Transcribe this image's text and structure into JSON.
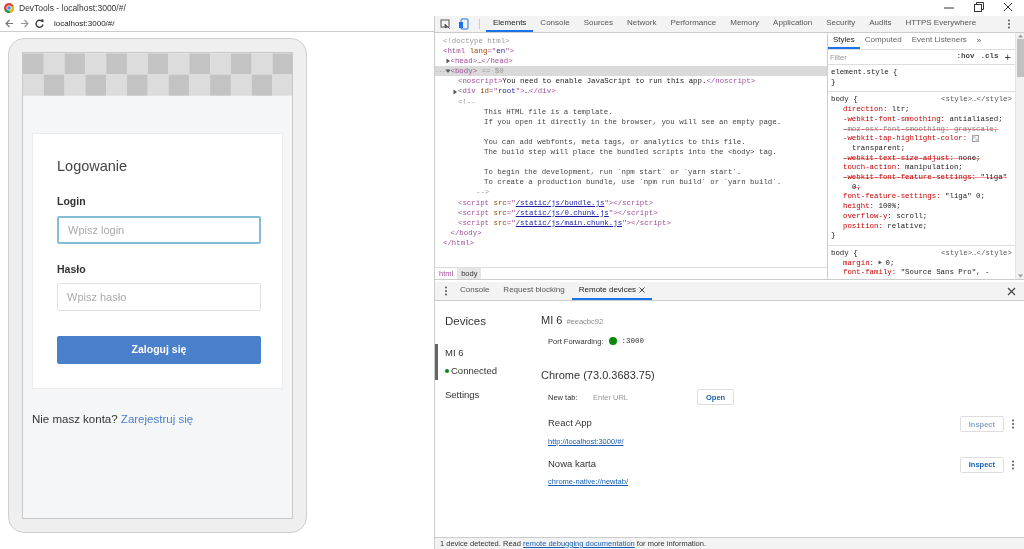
{
  "window": {
    "title": "DevTools - localhost:3000/#/"
  },
  "address_bar": {
    "url": "localhost:3000/#/"
  },
  "phone": {
    "heading": "Logowanie",
    "fields": [
      {
        "label": "Login",
        "placeholder": "Wpisz login",
        "focused": true
      },
      {
        "label": "Hasło",
        "placeholder": "Wpisz hasło",
        "focused": false
      }
    ],
    "submit": "Zaloguj się",
    "signup_prompt": "Nie masz konta?",
    "signup_link": "Zarejestruj się"
  },
  "devtools": {
    "tabs": [
      {
        "label": "Elements",
        "selected": true
      },
      {
        "label": "Console",
        "selected": false
      },
      {
        "label": "Sources",
        "selected": false
      },
      {
        "label": "Network",
        "selected": false
      },
      {
        "label": "Performance",
        "selected": false
      },
      {
        "label": "Memory",
        "selected": false
      },
      {
        "label": "Application",
        "selected": false
      },
      {
        "label": "Security",
        "selected": false
      },
      {
        "label": "Audits",
        "selected": false
      },
      {
        "label": "HTTPS Everywhere",
        "selected": false
      }
    ],
    "elements": {
      "tree": [
        {
          "selected": false,
          "parts": [
            {
              "kind": "muted",
              "text": "<!doctype html>"
            }
          ]
        },
        {
          "selected": false,
          "parts": [
            {
              "kind": "tag",
              "text": "<html "
            },
            {
              "kind": "attr",
              "text": "lang"
            },
            {
              "kind": "tag",
              "text": "=\""
            },
            {
              "kind": "val",
              "text": "en"
            },
            {
              "kind": "tag",
              "text": "\">"
            }
          ],
          "children": [
            {
              "selected": false,
              "expanded": false,
              "parts": [
                {
                  "kind": "tag",
                  "text": "<head>"
                },
                {
                  "kind": "plain",
                  "text": "…"
                },
                {
                  "kind": "tag",
                  "text": "</head>"
                }
              ]
            },
            {
              "selected": true,
              "expanded": true,
              "gutter": "...",
              "parts": [
                {
                  "kind": "tag",
                  "text": "<body>"
                },
                {
                  "kind": "muted",
                  "text": " == $0"
                }
              ],
              "children": [
                {
                  "selected": false,
                  "parts": [
                    {
                      "kind": "tag",
                      "text": "<noscript>"
                    },
                    {
                      "kind": "plain",
                      "text": "You need to enable JavaScript to run this app."
                    },
                    {
                      "kind": "tag",
                      "text": "</noscript>"
                    }
                  ]
                },
                {
                  "selected": false,
                  "expanded": false,
                  "parts": [
                    {
                      "kind": "tag",
                      "text": "<div "
                    },
                    {
                      "kind": "attr",
                      "text": "id"
                    },
                    {
                      "kind": "tag",
                      "text": "=\""
                    },
                    {
                      "kind": "val",
                      "text": "root"
                    },
                    {
                      "kind": "tag",
                      "text": "\">"
                    },
                    {
                      "kind": "plain",
                      "text": "…"
                    },
                    {
                      "kind": "tag",
                      "text": "</div>"
                    }
                  ]
                },
                {
                  "selected": false,
                  "parts": [
                    {
                      "kind": "muted",
                      "text": "<!--"
                    }
                  ],
                  "paragraphs": [
                    [
                      "This HTML file is a template.",
                      "If you open it directly in the browser, you will see an empty page."
                    ],
                    [
                      "You can add webfonts, meta tags, or analytics to this file.",
                      "The build step will place the bundled scripts into the <body> tag."
                    ],
                    [
                      "To begin the development, run `npm start` or `yarn start`.",
                      "To create a production bundle, use `npm run build` or `yarn build`."
                    ]
                  ],
                  "close": "-->"
                },
                {
                  "selected": false,
                  "parts": [
                    {
                      "kind": "tag",
                      "text": "<script "
                    },
                    {
                      "kind": "attr",
                      "text": "src"
                    },
                    {
                      "kind": "tag",
                      "text": "=\""
                    },
                    {
                      "kind": "link",
                      "text": "/static/js/bundle.js"
                    },
                    {
                      "kind": "tag",
                      "text": "\"></script>"
                    }
                  ]
                },
                {
                  "selected": false,
                  "parts": [
                    {
                      "kind": "tag",
                      "text": "<script "
                    },
                    {
                      "kind": "attr",
                      "text": "src"
                    },
                    {
                      "kind": "tag",
                      "text": "=\""
                    },
                    {
                      "kind": "link",
                      "text": "/static/js/0.chunk.js"
                    },
                    {
                      "kind": "tag",
                      "text": "\"></script>"
                    }
                  ]
                },
                {
                  "selected": false,
                  "parts": [
                    {
                      "kind": "tag",
                      "text": "<script "
                    },
                    {
                      "kind": "attr",
                      "text": "src"
                    },
                    {
                      "kind": "tag",
                      "text": "=\""
                    },
                    {
                      "kind": "link",
                      "text": "/static/js/main.chunk.js"
                    },
                    {
                      "kind": "tag",
                      "text": "\"></script>"
                    }
                  ]
                }
              ],
              "close": "</body>"
            }
          ],
          "close": "</html>"
        }
      ],
      "breadcrumbs": [
        {
          "label": "html",
          "selected": false
        },
        {
          "label": "body",
          "selected": true
        }
      ]
    },
    "styles": {
      "tabs": [
        {
          "label": "Styles",
          "selected": true
        },
        {
          "label": "Computed",
          "selected": false
        },
        {
          "label": "Event Listeners",
          "selected": false
        }
      ],
      "more": "»",
      "filter_placeholder": "Filter",
      "hov": ":hov",
      "cls": ".cls",
      "add": "+",
      "rules": [
        {
          "selector": "element.style {",
          "close": "}"
        },
        {
          "selector": "body {",
          "source": "<style>…</style>",
          "close": "}",
          "declarations": [
            {
              "name": "direction:",
              "value": "ltr;",
              "struck": false,
              "inactive": false
            },
            {
              "name": "-webkit-font-smoothing:",
              "value": "antialiased;",
              "struck": false,
              "inactive": false
            },
            {
              "name": "-moz-osx-font-smoothing:",
              "value": "grayscale;",
              "struck": true,
              "inactive": true
            },
            {
              "name": "-webkit-tap-highlight-color:",
              "value": "transparent;",
              "struck": false,
              "inactive": false,
              "swatch": true
            },
            {
              "name": "-webkit-text-size-adjust:",
              "value": "none;",
              "struck": true,
              "inactive": false
            },
            {
              "name": "touch-action:",
              "value": "manipulation;",
              "struck": false,
              "inactive": false
            },
            {
              "name": "-webkit-font-feature-settings:",
              "value": "\"liga\" 0;",
              "struck": true,
              "inactive": false
            },
            {
              "name": "font-feature-settings:",
              "value": "\"liga\" 0;",
              "struck": false,
              "inactive": false
            },
            {
              "name": "height:",
              "value": "100%;",
              "struck": false,
              "inactive": false
            },
            {
              "name": "overflow-y:",
              "value": "scroll;",
              "struck": false,
              "inactive": false
            },
            {
              "name": "position:",
              "value": "relative;",
              "struck": false,
              "inactive": false
            }
          ]
        },
        {
          "selector": "body {",
          "source": "<style>…</style>",
          "declarations": [
            {
              "name": "margin:",
              "value": "0;",
              "struck": false,
              "inactive": false,
              "expandable": true
            },
            {
              "name": "font-family:",
              "value": "\"Source Sans Pro\", -",
              "struck": false,
              "inactive": false
            }
          ]
        }
      ]
    },
    "drawer": {
      "tabs": [
        {
          "label": "Console",
          "selected": false,
          "closable": false
        },
        {
          "label": "Request blocking",
          "selected": false,
          "closable": false
        },
        {
          "label": "Remote devices",
          "selected": true,
          "closable": true
        }
      ],
      "sidebar": {
        "heading": "Devices",
        "items": [
          {
            "name": "MI 6",
            "status": "Connected",
            "selected": true
          },
          {
            "name": "Settings",
            "selected": false
          }
        ]
      },
      "device": {
        "name": "MI 6",
        "serial": "#eeacbc92",
        "port_label": "Port Forwarding:",
        "port": ":3000",
        "browser": "Chrome (73.0.3683.75)",
        "new_tab_label": "New tab:",
        "new_tab_placeholder": "Enter URL",
        "open": "Open",
        "pages": [
          {
            "title": "React App",
            "url": "http://localhost:3000/#/",
            "inspect": "Inspect",
            "disabled": true
          },
          {
            "title": "Nowa karta",
            "url": "chrome-native://newtab/",
            "inspect": "Inspect",
            "disabled": false
          }
        ]
      }
    },
    "status": {
      "before": "1 device detected. Read",
      "link": "remote debugging documentation",
      "after": "for more information."
    }
  }
}
